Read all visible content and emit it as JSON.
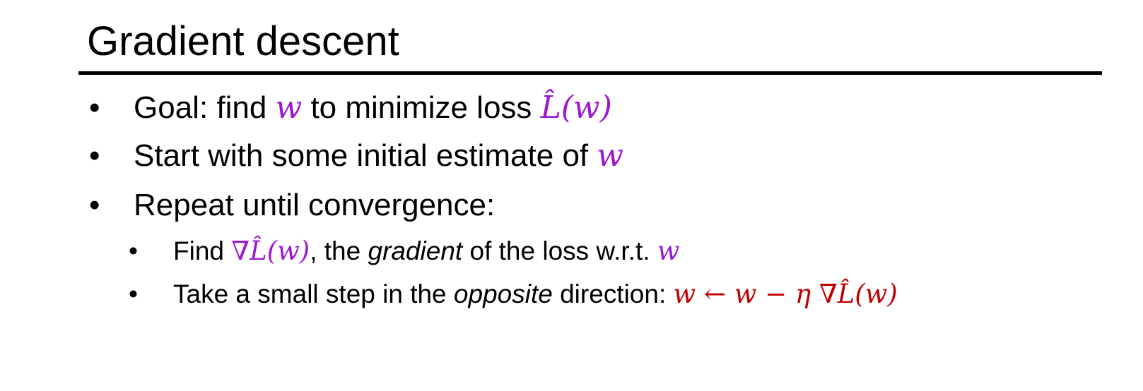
{
  "slide": {
    "title": "Gradient descent",
    "bullet_char": "•",
    "colors": {
      "math_purple": "#9b18d2",
      "math_red": "#c00000",
      "text": "#000000",
      "background": "#ffffff"
    },
    "bullets": [
      {
        "level": 1,
        "parts": [
          {
            "text": "Goal: find ",
            "style": "plain"
          },
          {
            "text": "w",
            "style": "math-purple"
          },
          {
            "text": " to minimize loss ",
            "style": "plain"
          },
          {
            "text": "L̂(w)",
            "style": "math-purple"
          }
        ]
      },
      {
        "level": 1,
        "parts": [
          {
            "text": "Start with some initial estimate of ",
            "style": "plain"
          },
          {
            "text": "w",
            "style": "math-purple"
          }
        ]
      },
      {
        "level": 1,
        "parts": [
          {
            "text": "Repeat until convergence:",
            "style": "plain"
          }
        ]
      },
      {
        "level": 2,
        "parts": [
          {
            "text": "Find ",
            "style": "plain"
          },
          {
            "text": "∇L̂(w)",
            "style": "math-purple"
          },
          {
            "text": ", the ",
            "style": "plain"
          },
          {
            "text": "gradient",
            "style": "italic"
          },
          {
            "text": " of the loss w.r.t. ",
            "style": "plain"
          },
          {
            "text": "w",
            "style": "math-purple"
          }
        ]
      },
      {
        "level": 2,
        "parts": [
          {
            "text": "Take a small step in the ",
            "style": "plain"
          },
          {
            "text": "opposite",
            "style": "italic"
          },
          {
            "text": " direction: ",
            "style": "plain"
          },
          {
            "text": "w ← w − η ∇L̂(w)",
            "style": "math-red"
          }
        ]
      }
    ]
  }
}
